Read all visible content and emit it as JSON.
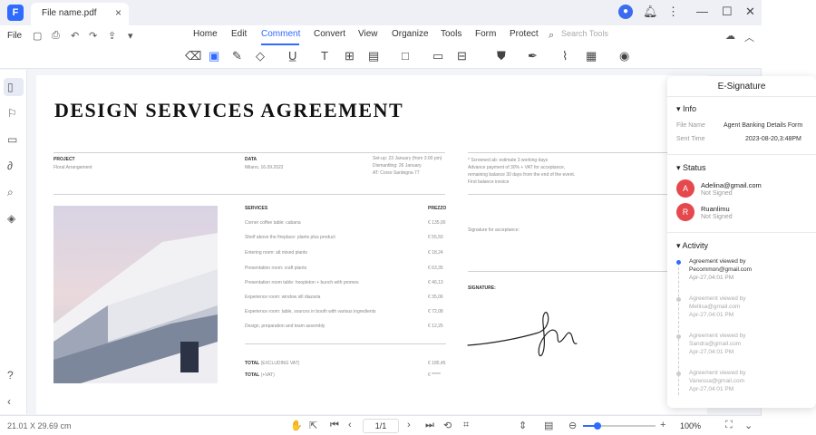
{
  "app": {
    "logo": "F",
    "tab_title": "File name.pdf",
    "tab_close": "×",
    "user_initial": "👤",
    "window_controls": [
      "—",
      "☐",
      "✕"
    ]
  },
  "menu": {
    "file": "File",
    "items": [
      "Home",
      "Edit",
      "Comment",
      "Convert",
      "View",
      "Organize",
      "Tools",
      "Form",
      "Protect"
    ],
    "active": "Comment",
    "search_placeholder": "Search Tools"
  },
  "document": {
    "title": "DESIGN SERVICES AGREEMENT",
    "project_label": "PROJECT",
    "project_value": "Floral Arrangement",
    "data_label": "DATA",
    "data_value": "Milano, 16.09.2022",
    "setup_lines": [
      "Set-up: 23 January (from 3:00 pm)",
      "Dismantling: 26 January",
      "AT: Corso Sardegna 77"
    ],
    "terms_lines": [
      "* Screened ab: estimate 3 working days",
      "Advance payment of 30% + VAT for acceptance,",
      "remaining balance 30 days from the end of the event.",
      "First balance invoice"
    ],
    "services_label": "SERVICES",
    "prices_label": "PREZZO",
    "services": [
      {
        "name": "Corner coffee table: cabana",
        "price": "€ 135,00"
      },
      {
        "name": "Shelf above the fireplace: plants plus product",
        "price": "€ 55,50"
      },
      {
        "name": "Entering room: alt mixed plants",
        "price": "€ 18,24"
      },
      {
        "name": "Presentation room: craft plants",
        "price": "€ 63,35"
      },
      {
        "name": "Presentation room table: hoopleton + bunch with promes",
        "price": "€ 46,13"
      },
      {
        "name": "Experience room: window sill diazaria",
        "price": "€ 35,06"
      },
      {
        "name": "Experience room: table, sources in booth with various ingredients",
        "price": "€ 72,08"
      },
      {
        "name": "Design, preparation and team assembly",
        "price": "€ 12,25"
      }
    ],
    "total_label": "TOTAL",
    "total_excl": "(EXCLUDING VAT)",
    "total_excl_value": "€ 185,45",
    "total_incl": "(+VAT)",
    "total_incl_value": "€ *****",
    "signature_note": "Signature for acceptance:",
    "signature_label": "SIGNATURE:"
  },
  "panel": {
    "title": "E-Signature",
    "info": {
      "heading": "Info",
      "file_name_label": "File Name",
      "file_name_value": "Agent Banking Details Form",
      "sent_time_label": "Sent Time",
      "sent_time_value": "2023-08-20,3:48PM"
    },
    "status": {
      "heading": "Status",
      "signers": [
        {
          "initial": "A",
          "email": "Adelina@gmail.com",
          "state": "Not Signed"
        },
        {
          "initial": "R",
          "email": "Ruanlimu",
          "state": "Not Signed"
        }
      ]
    },
    "activity": {
      "heading": "Activity",
      "events": [
        {
          "line1": "Agreement viewed by",
          "line2": "Pecommon@gmail.com",
          "time": "Apr-27,04:01 PM"
        },
        {
          "line1": "Agreement viewed by",
          "line2": "Mellisa@gmail.com",
          "time": "Apr-27,04:01 PM"
        },
        {
          "line1": "Agreement viewed by",
          "line2": "Sandra@gmail.com",
          "time": "Apr-27,04:01 PM"
        },
        {
          "line1": "Agreement viewed by",
          "line2": "Vanessa@gmail.com",
          "time": "Apr-27,04:01 PM"
        }
      ]
    }
  },
  "statusbar": {
    "page_size": "21.01 X 29.69 cm",
    "page_indicator": "1/1",
    "zoom": "100%",
    "zoom_level": 0.2
  },
  "colors": {
    "accent": "#2f6bff",
    "avatar_red": "#e5484d"
  }
}
